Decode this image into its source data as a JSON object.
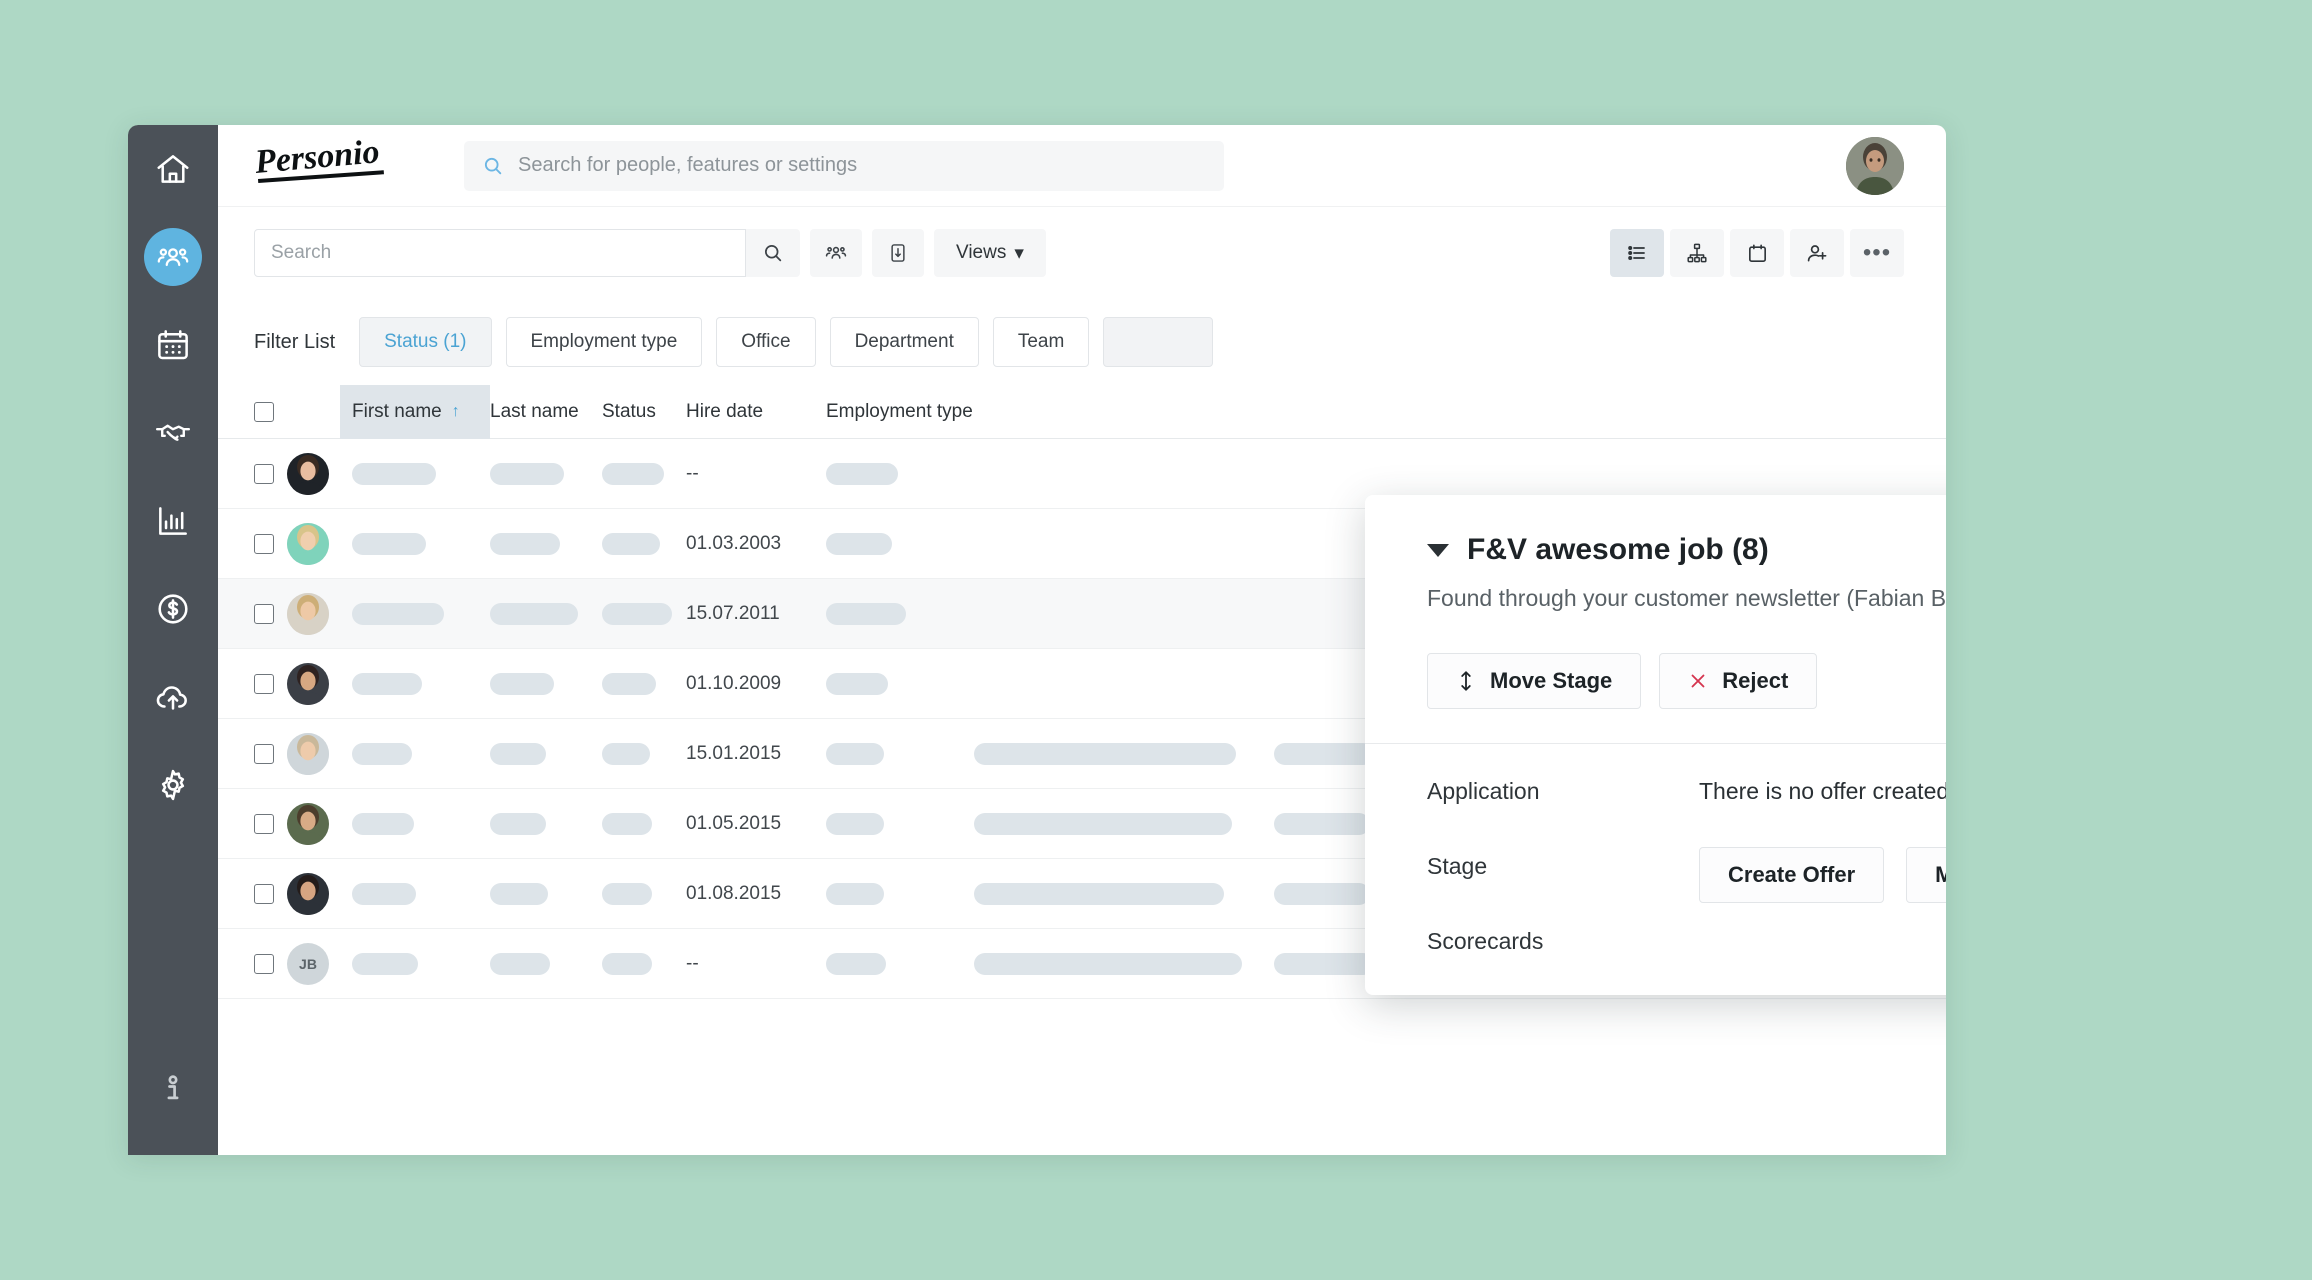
{
  "theme": {
    "page_background": "#aed8c5",
    "sidebar_background": "#4b5158",
    "accent_blue": "#4ba3d3",
    "active_nav_background": "#5fb4e0",
    "reject_red": "#d5354f",
    "skeleton": "#dde4e9"
  },
  "sidebar": {
    "items": [
      {
        "icon": "home-icon",
        "name": "home",
        "active": false
      },
      {
        "icon": "people-icon",
        "name": "employees",
        "active": true
      },
      {
        "icon": "calendar-icon",
        "name": "absence",
        "active": false
      },
      {
        "icon": "handshake-icon",
        "name": "recruiting",
        "active": false
      },
      {
        "icon": "bar-chart-icon",
        "name": "reports",
        "active": false
      },
      {
        "icon": "dollar-circle-icon",
        "name": "payroll",
        "active": false
      },
      {
        "icon": "cloud-upload-icon",
        "name": "documents",
        "active": false
      },
      {
        "icon": "gear-icon",
        "name": "settings",
        "active": false
      }
    ],
    "bottom": {
      "icon": "info-icon",
      "name": "help"
    }
  },
  "topbar": {
    "logo_text": "Personio",
    "search": {
      "placeholder": "Search for people, features or settings",
      "value": "",
      "icon": "search-icon"
    },
    "avatar": {
      "name": "user-avatar",
      "initials": ""
    }
  },
  "toolbar": {
    "search": {
      "placeholder": "Search",
      "value": ""
    },
    "search_button_icon": "search-icon",
    "people_button_icon": "people-group-icon",
    "export_button_icon": "document-icon",
    "views_label": "Views",
    "views_caret": "▾",
    "right_tools": [
      {
        "icon": "list-view-icon",
        "name": "list-view",
        "active": true
      },
      {
        "icon": "org-chart-icon",
        "name": "org-chart-view",
        "active": false
      },
      {
        "icon": "calendar-icon",
        "name": "calendar-view",
        "active": false
      },
      {
        "icon": "add-person-icon",
        "name": "add-employee",
        "active": false
      },
      {
        "icon": "more-icon",
        "name": "more-options",
        "active": false,
        "label": "•••"
      }
    ]
  },
  "filters": {
    "label": "Filter List",
    "chips": [
      {
        "label": "Status (1)",
        "active": true
      },
      {
        "label": "Employment type",
        "active": false
      },
      {
        "label": "Office",
        "active": false
      },
      {
        "label": "Department",
        "active": false
      },
      {
        "label": "Team",
        "active": false
      }
    ]
  },
  "table": {
    "headers": {
      "first_name": "First name",
      "last_name": "Last name",
      "status": "Status",
      "hire_date": "Hire date",
      "employment_type": "Employment type",
      "sort_indicator": "↑"
    },
    "rows": [
      {
        "hire_date": "--",
        "avatar": "avatar-photo-1",
        "highlight": false,
        "initials": ""
      },
      {
        "hire_date": "01.03.2003",
        "avatar": "avatar-photo-2",
        "highlight": false,
        "initials": ""
      },
      {
        "hire_date": "15.07.2011",
        "avatar": "avatar-photo-3",
        "highlight": true,
        "initials": ""
      },
      {
        "hire_date": "01.10.2009",
        "avatar": "avatar-photo-4",
        "highlight": false,
        "initials": ""
      },
      {
        "hire_date": "15.01.2015",
        "avatar": "avatar-photo-5",
        "highlight": false,
        "initials": ""
      },
      {
        "hire_date": "01.05.2015",
        "avatar": "avatar-photo-6",
        "highlight": false,
        "initials": ""
      },
      {
        "hire_date": "01.08.2015",
        "avatar": "avatar-photo-7",
        "highlight": false,
        "initials": ""
      },
      {
        "hire_date": "--",
        "avatar": "avatar-initials",
        "highlight": false,
        "initials": "JB"
      }
    ]
  },
  "modal": {
    "caret": "▼",
    "title": "F&V awesome job (8)",
    "subtitle": "Found through your customer newsletter (Fabian Brunn)",
    "edit_icon": "pencil-icon",
    "move_stage_label": "Move Stage",
    "move_stage_icon": "up-down-arrow-icon",
    "reject_label": "Reject",
    "reject_icon": "x-icon",
    "sections": [
      "Application",
      "Stage",
      "Scorecards"
    ],
    "offer_message": "There is no offer created yet for this job.",
    "create_offer_label": "Create Offer",
    "mark_hired_label": "Mark Candidate as Hired"
  }
}
